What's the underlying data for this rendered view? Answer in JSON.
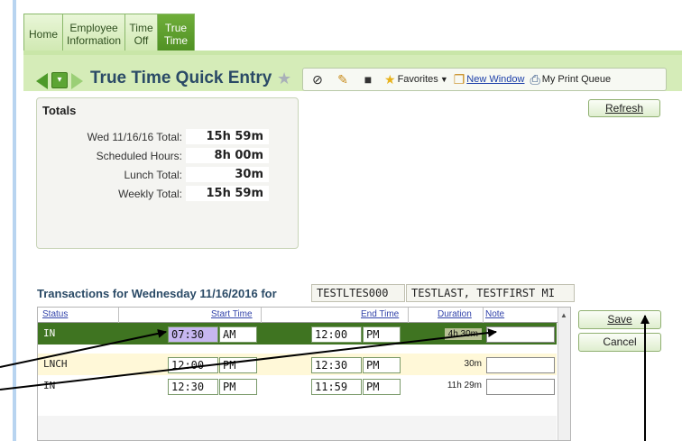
{
  "tabs": [
    {
      "label_line1": "Home",
      "label_line2": ""
    },
    {
      "label_line1": "Employee",
      "label_line2": "Information"
    },
    {
      "label_line1": "Time",
      "label_line2": "Off"
    },
    {
      "label_line1": "True",
      "label_line2": "Time"
    }
  ],
  "active_tab": "True Time",
  "page": {
    "title": "True Time Quick Entry"
  },
  "toolbar": {
    "favorites_label": "Favorites",
    "new_window_label": "New Window",
    "print_queue_label": "My Print Queue"
  },
  "totals": {
    "title": "Totals",
    "rows": [
      {
        "label": "Wed 11/16/16 Total:",
        "value": "15h 59m"
      },
      {
        "label": "Scheduled Hours:",
        "value": "8h 00m"
      },
      {
        "label": "Lunch Total:",
        "value": "30m"
      },
      {
        "label": "Weekly Total:",
        "value": "15h 59m"
      }
    ]
  },
  "refresh_label": "Refresh",
  "transactions": {
    "heading": "Transactions for Wednesday 11/16/2016 for",
    "employee_id": "TESTLTES000",
    "employee_name": "TESTLAST, TESTFIRST MI",
    "columns": {
      "status": "Status",
      "start": "Start Time",
      "end": "End Time",
      "duration": "Duration",
      "note": "Note"
    },
    "rows": [
      {
        "status": "IN",
        "start_time": "07:30",
        "start_ampm": "AM",
        "end_time": "12:00",
        "end_ampm": "PM",
        "duration": "4h 30m",
        "note": ""
      },
      {
        "status": "LNCH",
        "start_time": "12:00",
        "start_ampm": "PM",
        "end_time": "12:30",
        "end_ampm": "PM",
        "duration": "30m",
        "note": ""
      },
      {
        "status": "IN",
        "start_time": "12:30",
        "start_ampm": "PM",
        "end_time": "11:59",
        "end_ampm": "PM",
        "duration": "11h 29m",
        "note": ""
      }
    ]
  },
  "buttons": {
    "save": "Save",
    "cancel": "Cancel"
  },
  "colors": {
    "active_tab": "#4e8f22",
    "selected_row": "#3f7421",
    "lunch_row": "#fff8d8",
    "title_text": "#2a4a66"
  }
}
